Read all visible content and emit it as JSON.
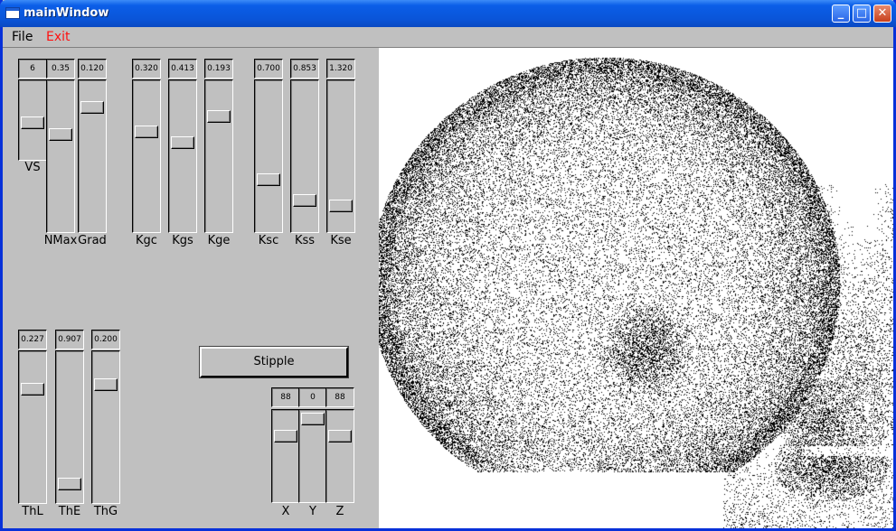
{
  "window": {
    "title": "mainWindow",
    "min_label": "_",
    "max_label": "□",
    "close_label": "✕"
  },
  "menu": {
    "file": "File",
    "exit": "Exit",
    "exit_color": "#ff1010"
  },
  "sliders": [
    {
      "key": "vs",
      "label": "VS",
      "value": "6",
      "pos": 0.55
    },
    {
      "key": "nmax",
      "label": "NMax",
      "value": "0.35",
      "pos": 0.35
    },
    {
      "key": "grad",
      "label": "Grad",
      "value": "0.120",
      "pos": 0.15
    },
    {
      "key": "kgc",
      "label": "Kgc",
      "value": "0.320",
      "pos": 0.33
    },
    {
      "key": "kgs",
      "label": "Kgs",
      "value": "0.413",
      "pos": 0.41
    },
    {
      "key": "kge",
      "label": "Kge",
      "value": "0.193",
      "pos": 0.22
    },
    {
      "key": "ksc",
      "label": "Ksc",
      "value": "0.700",
      "pos": 0.68
    },
    {
      "key": "kss",
      "label": "Kss",
      "value": "0.853",
      "pos": 0.83
    },
    {
      "key": "kse",
      "label": "Kse",
      "value": "1.320",
      "pos": 0.87
    },
    {
      "key": "thl",
      "label": "ThL",
      "value": "0.227",
      "pos": 0.23
    },
    {
      "key": "the",
      "label": "ThE",
      "value": "0.907",
      "pos": 0.92
    },
    {
      "key": "thg",
      "label": "ThG",
      "value": "0.200",
      "pos": 0.2
    },
    {
      "key": "x",
      "label": "X",
      "value": "88",
      "pos": 0.25
    },
    {
      "key": "y",
      "label": "Y",
      "value": "0",
      "pos": 0.03
    },
    {
      "key": "z",
      "label": "Z",
      "value": "88",
      "pos": 0.25
    }
  ],
  "stipple_button": "Stipple",
  "image": {
    "subject": "stippled skull"
  }
}
